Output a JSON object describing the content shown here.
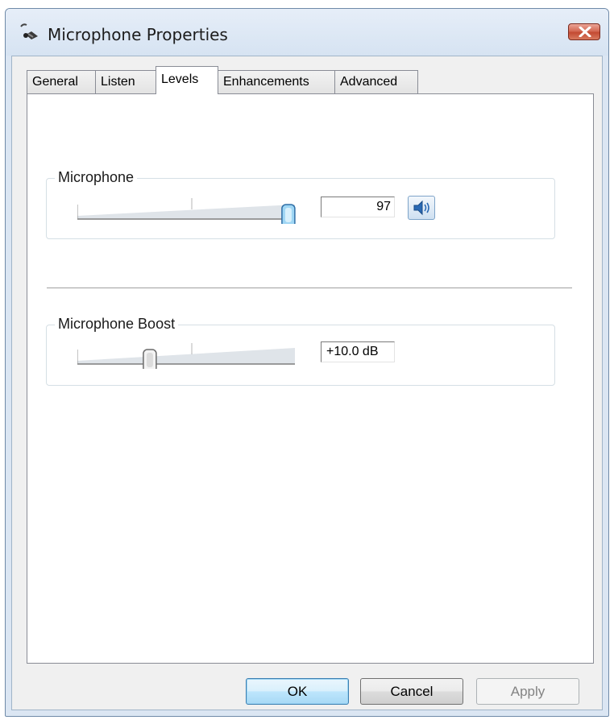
{
  "window": {
    "title": "Microphone Properties"
  },
  "tabs": [
    {
      "label": "General"
    },
    {
      "label": "Listen"
    },
    {
      "label": "Levels"
    },
    {
      "label": "Enhancements"
    },
    {
      "label": "Advanced"
    }
  ],
  "active_tab": "Levels",
  "microphone": {
    "group_label": "Microphone",
    "level_value": "97",
    "level_fraction": 0.97,
    "speaker_icon": "speaker-icon"
  },
  "boost": {
    "group_label": "Microphone Boost",
    "value": "+10.0 dB",
    "level_fraction": 0.333
  },
  "buttons": {
    "ok": "OK",
    "cancel": "Cancel",
    "apply": "Apply"
  },
  "colors": {
    "window_frame": "#dbe6f3",
    "close_button": "#c34a32",
    "default_button": "#bee6fd"
  }
}
